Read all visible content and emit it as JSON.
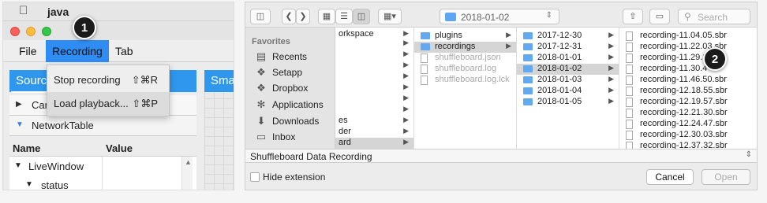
{
  "left_app": {
    "app_name": "java",
    "menu": {
      "file": "File",
      "recording": "Recording",
      "tab": "Tab"
    },
    "dropdown": [
      {
        "label": "Stop recording",
        "shortcut": "⇧⌘R"
      },
      {
        "label": "Load playback...",
        "shortcut": "⇧⌘P"
      }
    ],
    "sources_tab": "Sourc",
    "sma_tab": "Sma",
    "tree": {
      "cam": "Cam",
      "networktable": "NetworkTable"
    },
    "table": {
      "name_header": "Name",
      "value_header": "Value",
      "row1": "LiveWindow",
      "row2": "status"
    }
  },
  "file_dialog": {
    "path": "2018-01-02",
    "search_placeholder": "Search",
    "sidebar": {
      "heading": "Favorites",
      "items": [
        "Recents",
        "Setapp",
        "Dropbox",
        "Applications",
        "Downloads",
        "Inbox"
      ]
    },
    "col0": [
      "orkspace",
      "",
      "",
      "",
      "",
      "",
      "",
      "",
      "es",
      "der",
      "ard"
    ],
    "col1": [
      {
        "name": "plugins",
        "type": "folder",
        "dim": false
      },
      {
        "name": "recordings",
        "type": "folder",
        "dim": false
      },
      {
        "name": "shuffleboard.json",
        "type": "file",
        "dim": true
      },
      {
        "name": "shuffleboard.log",
        "type": "file",
        "dim": true
      },
      {
        "name": "shuffleboard.log.lck",
        "type": "file",
        "dim": true
      }
    ],
    "col2": [
      "2017-12-30",
      "2017-12-31",
      "2018-01-01",
      "2018-01-02",
      "2018-01-03",
      "2018-01-04",
      "2018-01-05"
    ],
    "col3": [
      "recording-11.04.05.sbr",
      "recording-11.22.03.sbr",
      "recording-11.29.1",
      "recording-11.30.4",
      "recording-11.46.50.sbr",
      "recording-12.18.55.sbr",
      "recording-12.19.57.sbr",
      "recording-12.21.30.sbr",
      "recording-12.24.47.sbr",
      "recording-12.30.03.sbr",
      "recording-12.37.32.sbr"
    ],
    "filter": "Shuffleboard Data Recording",
    "hide_extension": "Hide extension",
    "cancel": "Cancel",
    "open": "Open"
  },
  "badges": {
    "one": "1",
    "two": "2"
  },
  "colors": {
    "accent": "#2f97ee",
    "folder": "#63a9f2"
  }
}
